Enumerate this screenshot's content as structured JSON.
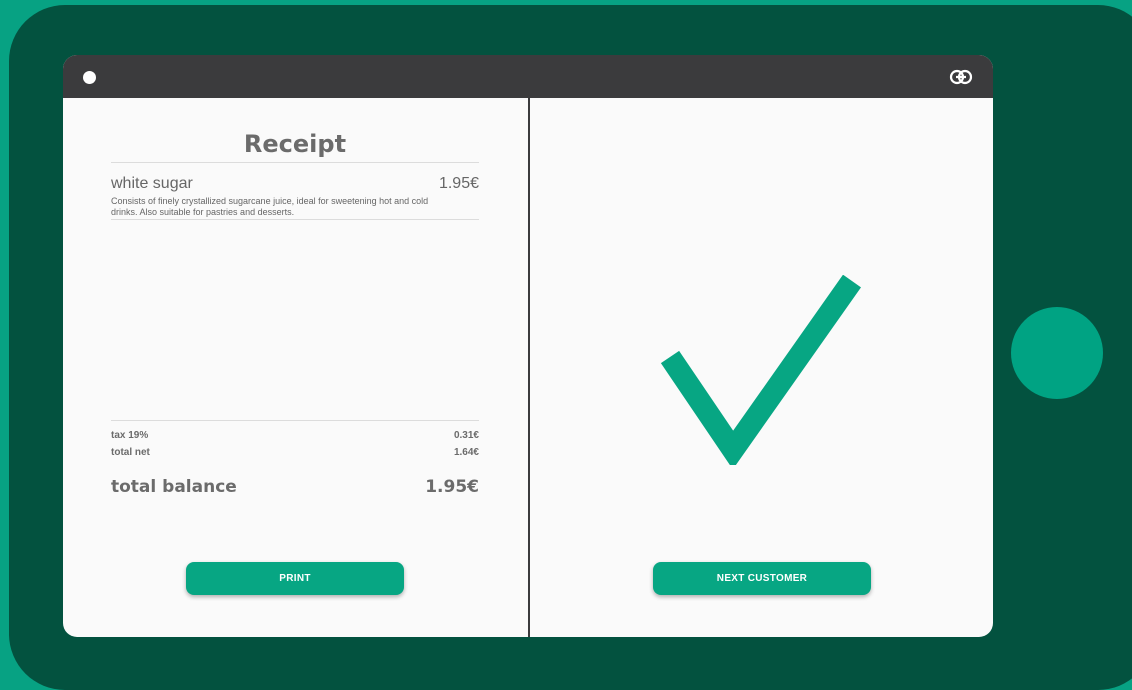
{
  "receipt": {
    "title": "Receipt",
    "items": [
      {
        "name": "white sugar",
        "price": "1.95€",
        "description": "Consists of finely crystallized sugarcane juice, ideal for sweetening hot and cold drinks. Also suitable for pastries and desserts."
      }
    ],
    "tax_label": "tax 19%",
    "tax_value": "0.31€",
    "net_label": "total net",
    "net_value": "1.64€",
    "balance_label": "total balance",
    "balance_value": "1.95€"
  },
  "buttons": {
    "print_label": "PRINT",
    "next_label": "NEXT CUSTOMER"
  },
  "icons": {
    "topbar_left": "status-dot-icon",
    "topbar_right": "link-icon",
    "success": "checkmark-icon"
  },
  "colors": {
    "accent": "#07a683",
    "frame": "#03523f",
    "topbar": "#3b3b3d",
    "background": "#07a283"
  }
}
